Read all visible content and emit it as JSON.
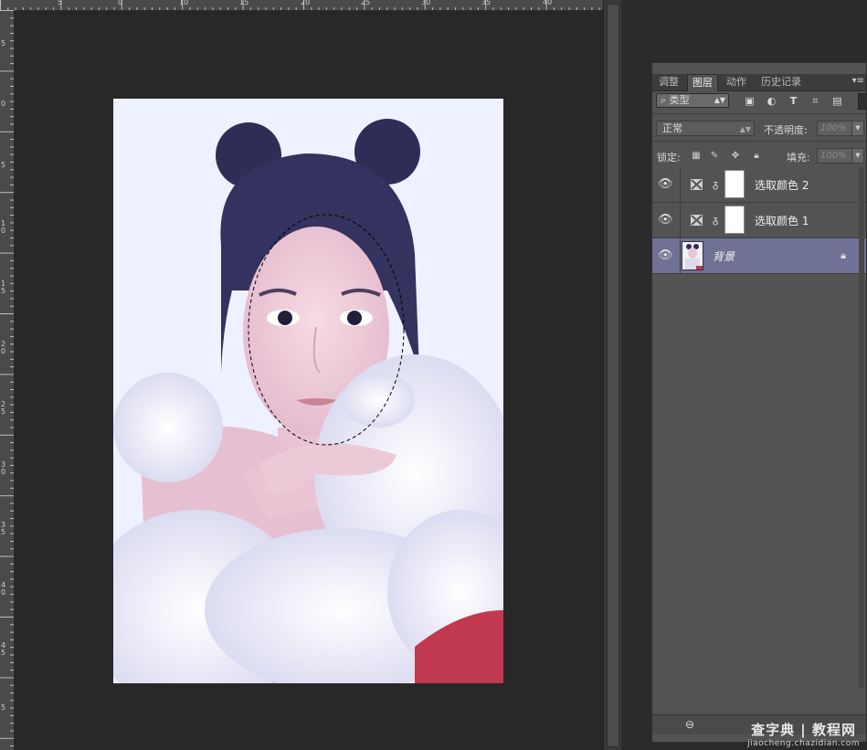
{
  "ruler": {
    "top_ticks": [
      "0",
      "5",
      "10",
      "15",
      "20",
      "25",
      "30",
      "35",
      "40"
    ],
    "left_ticks": [
      "5",
      "0",
      "5",
      "1\n0",
      "1\n5",
      "2\n0",
      "2\n5",
      "3\n0",
      "3\n5",
      "4\n0",
      "4\n5",
      "5"
    ]
  },
  "panel": {
    "collapse_icon": "◂◂",
    "close_icon": "✕",
    "tabs": [
      {
        "label": "调整",
        "active": false
      },
      {
        "label": "图层",
        "active": true
      },
      {
        "label": "动作",
        "active": false
      },
      {
        "label": "历史记录",
        "active": false
      }
    ],
    "menu_icon": "▾≡",
    "filter": {
      "search_icon": "⌕",
      "kind_label": "类型",
      "icons": [
        "image-filter-icon",
        "adjustment-filter-icon",
        "type-filter-icon",
        "shape-filter-icon",
        "smart-object-filter-icon"
      ]
    },
    "blend_mode": "正常",
    "opacity_label": "不透明度:",
    "opacity_value": "100%",
    "lock_label": "锁定:",
    "fill_label": "填充:",
    "fill_value": "100%",
    "layers": [
      {
        "name": "选取颜色 2",
        "type": "adjustment",
        "selected": false,
        "visible": true
      },
      {
        "name": "选取颜色 1",
        "type": "adjustment",
        "selected": false,
        "visible": true
      },
      {
        "name": "背景",
        "type": "background",
        "selected": true,
        "visible": true,
        "locked": true
      }
    ],
    "footer_link_icon": "⊖"
  },
  "watermark": {
    "line1": "查字典 | 教程网",
    "line2": "jiaocheng.chazidian.com"
  }
}
